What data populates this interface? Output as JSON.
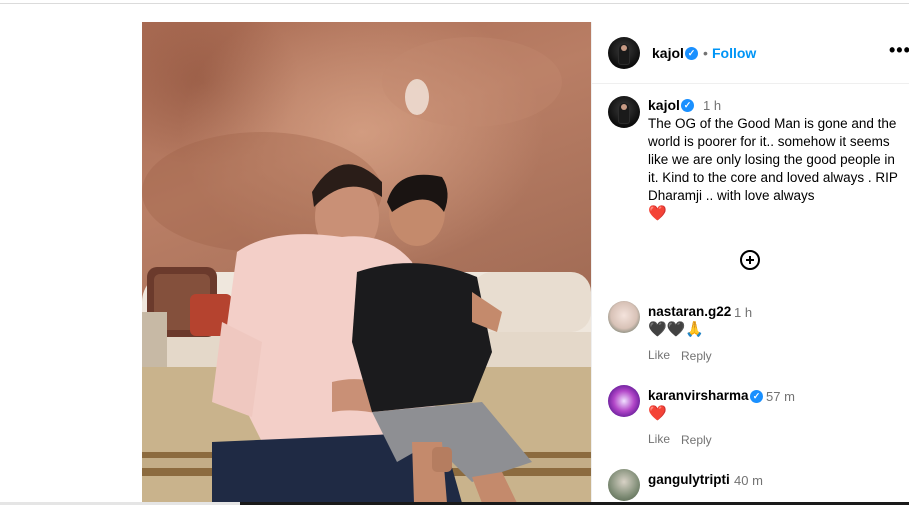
{
  "post": {
    "author": "kajol",
    "follow_label": "Follow",
    "separator": "•",
    "more_label": "•••",
    "caption_author": "kajol",
    "caption_time": "1 h",
    "caption_text": "The OG of the Good Man is gone and the world is poorer for it.. somehow it seems like we are only losing the good people in it. Kind to the core and loved always . RIP Dharamji .. with love always",
    "caption_emoji": "❤️"
  },
  "comments": [
    {
      "user": "nastaran.g22",
      "time": "1 h",
      "text": "🖤🖤🙏",
      "like": "Like",
      "reply": "Reply"
    },
    {
      "user": "karanvirsharma",
      "verified": true,
      "time": "57 m",
      "text": "❤️",
      "like": "Like",
      "reply": "Reply"
    },
    {
      "user": "gangulytripti",
      "time": "40 m"
    }
  ],
  "icons": {
    "verified": "verified-badge-icon",
    "more": "more-options-icon",
    "load_more": "plus-circle-icon"
  },
  "colors": {
    "accent": "#0095f6",
    "verified": "#1a90ff",
    "secondary_text": "#737373",
    "heart": "#e0245e"
  }
}
